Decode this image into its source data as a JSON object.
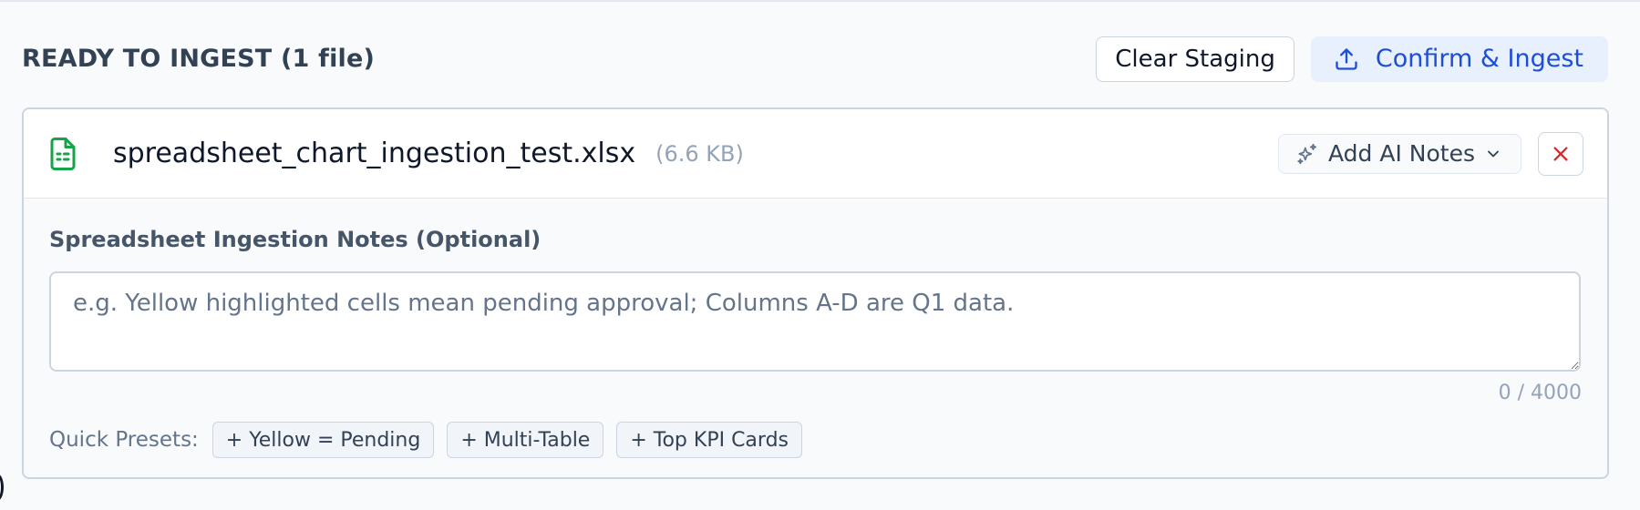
{
  "header": {
    "title": "READY TO INGEST (1 file)",
    "clear_label": "Clear Staging",
    "confirm_label": "Confirm & Ingest"
  },
  "file": {
    "name": "spreadsheet_chart_ingestion_test.xlsx",
    "size": "(6.6 KB)",
    "ai_notes_label": "Add AI Notes"
  },
  "notes": {
    "label": "Spreadsheet Ingestion Notes (Optional)",
    "value": "",
    "placeholder": "e.g. Yellow highlighted cells mean pending approval; Columns A-D are Q1 data.",
    "char_count": "0 / 4000"
  },
  "presets": {
    "label": "Quick Presets:",
    "items": [
      "+ Yellow = Pending",
      "+ Multi-Table",
      "+ Top KPI Cards"
    ]
  },
  "icons": {
    "confirm": "upload-icon",
    "file": "spreadsheet-file-icon",
    "ai": "sparkles-icon",
    "dropdown": "chevron-down-icon",
    "remove": "close-icon"
  },
  "colors": {
    "accent": "#1d4ed8",
    "accent_bg": "#e8f0fe",
    "file_icon": "#16a34a",
    "remove": "#dc2626"
  }
}
